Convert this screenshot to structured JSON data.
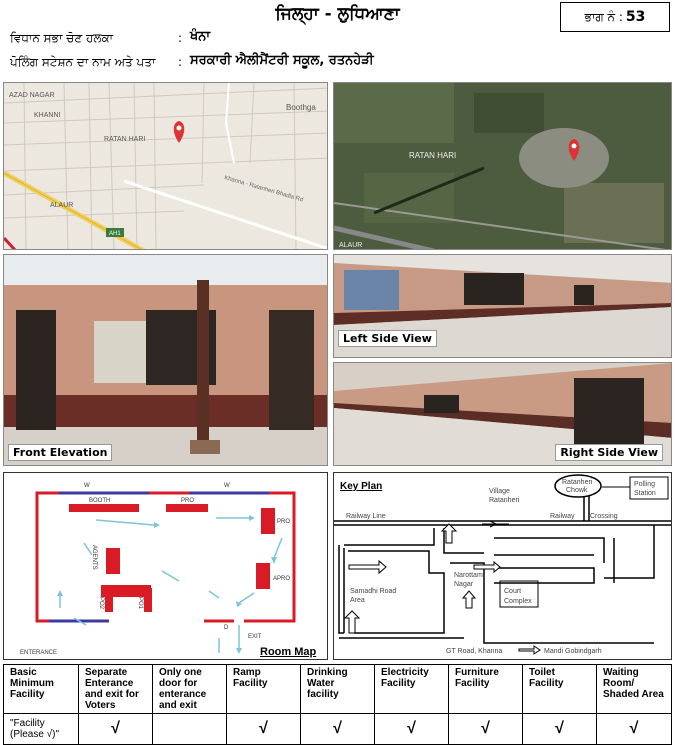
{
  "header": {
    "district_title": "ਜਿਲ੍ਹਾ - ਲੁਧਿਆਣਾ",
    "part_label": "ਭਾਗ ਨੰ :",
    "part_number": "53",
    "constituency_label": "ਵਿਧਾਨ ਸਭਾ ਚੋਣ ਹਲਕਾ",
    "constituency_value": "ਖੰਨਾ",
    "station_label": "ਪੋਲਿੰਗ ਸਟੇਸ਼ਨ ਦਾ ਨਾਮ ਅਤੇ ਪਤਾ",
    "station_value": "ਸਰਕਾਰੀ ਐਲੀਮੈਂਟਰੀ ਸਕੂਲ, ਰਤਨਹੇੜੀ",
    "colon": ":"
  },
  "road_map": {
    "labels": [
      "AZAD NAGAR",
      "KHANNI",
      "RATAN HARI",
      "Boothga",
      "ALAUR",
      "Khanna - Ratanheri Bhadla Rd",
      "AH1"
    ]
  },
  "satellite": {
    "labels": [
      "RATAN HARI",
      "ALAUR"
    ]
  },
  "photos": {
    "front": "Front Elevation",
    "left": "Left Side View",
    "right": "Right Side View"
  },
  "room_map": {
    "title": "Room Map",
    "labels": [
      "W",
      "W",
      "BOOTH",
      "PRO",
      "PRO",
      "APRO",
      "AGENTS",
      "PO2",
      "PO1",
      "ENTERANCE",
      "D",
      "EXIT"
    ]
  },
  "key_plan": {
    "title": "Key Plan",
    "labels": [
      "Village",
      "Ratanheri",
      "Ratanheri",
      "Chowk",
      "Polling",
      "Station",
      "Railway Line",
      "Railway",
      "Crossing",
      "Narottam",
      "Nagar",
      "Samadhi Road",
      "Area",
      "Court",
      "Complex",
      "GT Road, Khanna",
      "Mandi Gobindgarh"
    ]
  },
  "facilities": {
    "headers": [
      "Basic Minimum Facility",
      "Separate Enterance and exit for Voters",
      "Only one door for enterance and exit",
      "Ramp Facility",
      "Drinking Water facility",
      "Electricity Facility",
      "Furniture Facility",
      "Toilet Facility",
      "Waiting Room/ Shaded Area"
    ],
    "row_label": "\"Facility (Please √)\"",
    "values": [
      "√",
      "",
      "√",
      "√",
      "√",
      "√",
      "√",
      "√"
    ]
  }
}
